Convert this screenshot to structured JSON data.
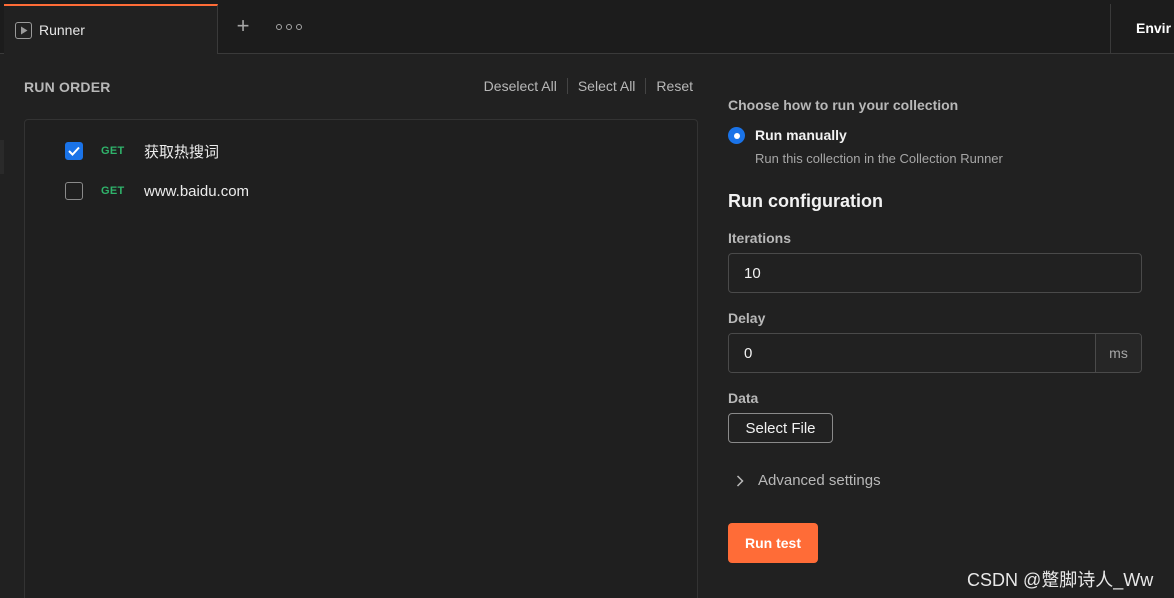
{
  "topbar": {
    "active_tab_label": "Runner",
    "add_tab_glyph": "+",
    "environment_label": "Envir"
  },
  "run_order": {
    "title": "RUN ORDER",
    "deselect_all": "Deselect All",
    "select_all": "Select All",
    "reset": "Reset",
    "requests": [
      {
        "method": "GET",
        "name": "获取热搜词",
        "checked": true
      },
      {
        "method": "GET",
        "name": "www.baidu.com",
        "checked": false
      }
    ]
  },
  "run_options": {
    "choose_title": "Choose how to run your collection",
    "manual_label": "Run manually",
    "manual_description": "Run this collection in the Collection Runner",
    "manual_selected": true
  },
  "config": {
    "title": "Run configuration",
    "iterations_label": "Iterations",
    "iterations_value": "10",
    "delay_label": "Delay",
    "delay_value": "0",
    "delay_unit": "ms",
    "data_label": "Data",
    "select_file_label": "Select File",
    "advanced_label": "Advanced settings",
    "run_button_label": "Run test"
  },
  "watermark": "CSDN @蹩脚诗人_Ww",
  "colors": {
    "accent": "#ff6c37",
    "checkbox_blue": "#1a73e8",
    "method_get": "#2fb36b",
    "background": "#212121"
  },
  "icons": {
    "runner_tab": "play-square-icon",
    "add_tab": "plus-icon",
    "more": "more-horizontal-icon",
    "check": "check-icon",
    "advanced": "chevron-right-icon"
  }
}
